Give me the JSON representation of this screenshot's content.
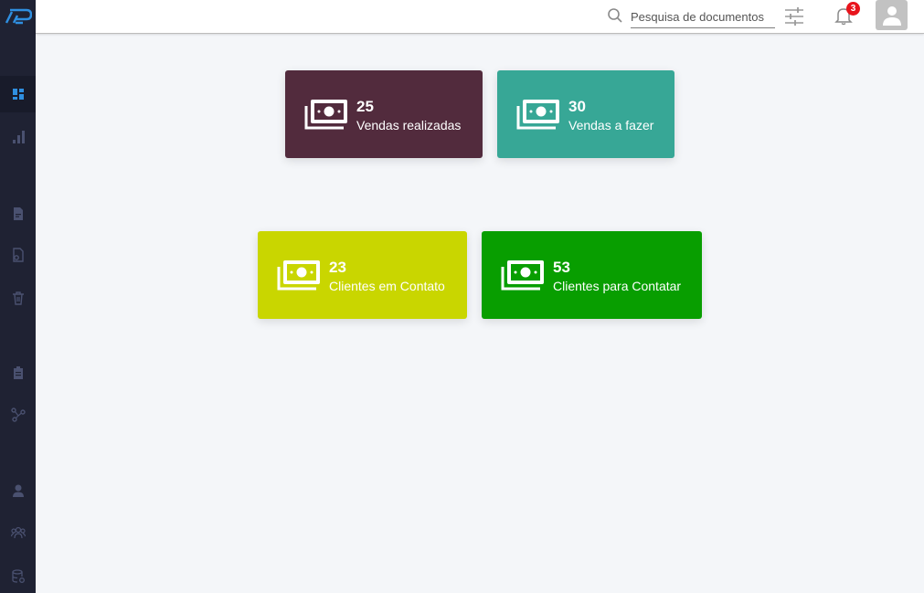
{
  "colors": {
    "sidebar": "#1f2233",
    "sidebar_icon": "#4a5170",
    "active_icon": "#2f8fe0",
    "card_sales_done": "#522b3d",
    "card_sales_todo": "#37a796",
    "card_clients_contacted": "#c9d600",
    "card_clients_to_contact": "#089e00",
    "badge": "#e8141c"
  },
  "sidebar": {
    "logo": "brand-logo-icon",
    "items": [
      {
        "icon": "dashboard-icon",
        "active": true
      },
      {
        "icon": "bar-chart-icon"
      },
      {
        "icon": "document-icon"
      },
      {
        "icon": "document-settings-icon"
      },
      {
        "icon": "trash-icon"
      },
      {
        "icon": "clipboard-icon"
      },
      {
        "icon": "workflow-icon"
      },
      {
        "icon": "user-icon"
      },
      {
        "icon": "users-group-icon"
      },
      {
        "icon": "database-settings-icon"
      }
    ]
  },
  "header": {
    "search_placeholder": "Pesquisa de documentos",
    "notification_count": "3"
  },
  "cards": [
    {
      "count": "25",
      "label": "Vendas realizadas"
    },
    {
      "count": "30",
      "label": "Vendas a fazer"
    },
    {
      "count": "23",
      "label": "Clientes em Contato"
    },
    {
      "count": "53",
      "label": "Clientes para Contatar"
    }
  ]
}
